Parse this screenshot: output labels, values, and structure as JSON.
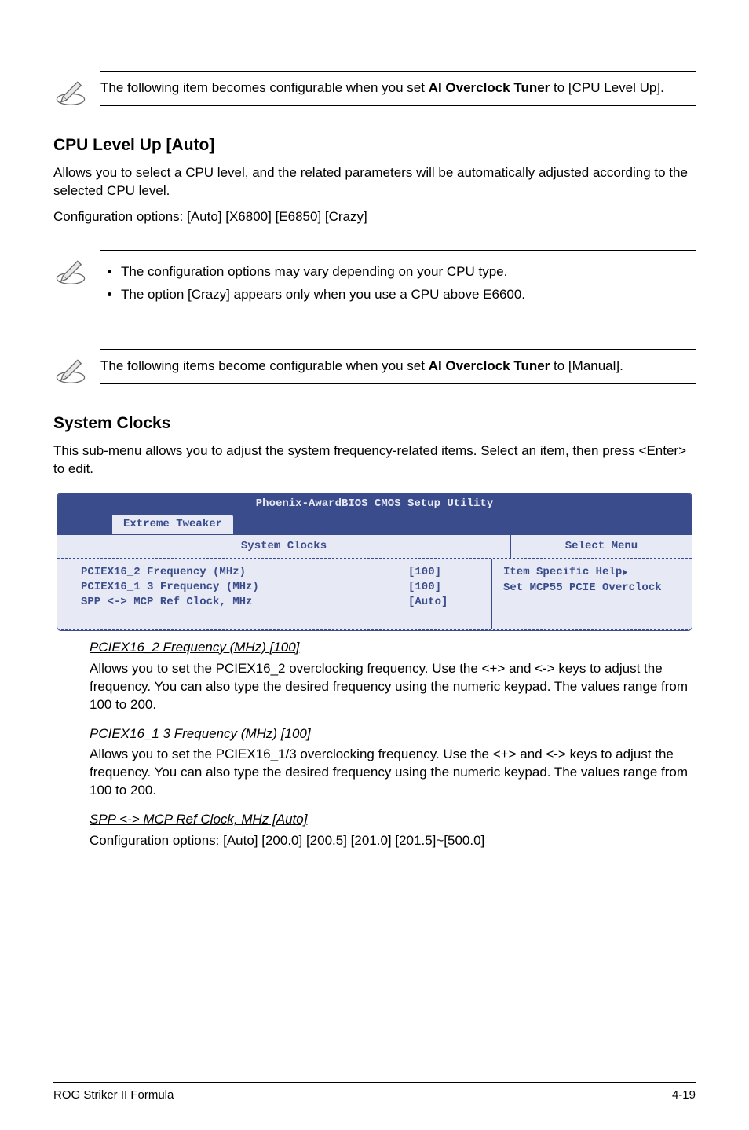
{
  "notes": {
    "note1": "The following item becomes configurable when you set <b>AI Overclock Tuner</b> to [CPU Level Up].",
    "note2_li1": "The configuration options may vary depending on your CPU type.",
    "note2_li2": "The option [Crazy] appears only when you use a CPU above E6600.",
    "note3": "The following items become configurable when you set <b>AI Overclock Tuner</b> to [Manual]."
  },
  "sections": {
    "cpu_level_up": {
      "heading": "CPU Level Up [Auto]",
      "p1": "Allows you to select a CPU level, and the related parameters will be automatically adjusted according to the selected CPU level.",
      "p2": "Configuration options: [Auto] [X6800] [E6850] [Crazy]"
    },
    "system_clocks": {
      "heading": "System Clocks",
      "p1": "This sub-menu allows you to adjust the system frequency-related items. Select an item, then press <Enter> to edit."
    }
  },
  "bios": {
    "title": "Phoenix-AwardBIOS CMOS Setup Utility",
    "tab": "Extreme Tweaker",
    "col_left": "System Clocks",
    "col_right": "Select Menu",
    "rows": [
      {
        "label": "PCIEX16_2 Frequency (MHz)",
        "value": "[100]"
      },
      {
        "label": "PCIEX16_1 3 Frequency (MHz)",
        "value": "[100]"
      },
      {
        "label": "SPP <-> MCP Ref Clock, MHz",
        "value": "[Auto]"
      }
    ],
    "help": {
      "line1": "Item Specific Help",
      "line2": "Set MCP55 PCIE Overclock"
    }
  },
  "details": {
    "d1_head": "PCIEX16_2 Frequency (MHz) [100]",
    "d1_body": "Allows you to set the PCIEX16_2 overclocking frequency. Use the <+> and <-> keys to adjust the frequency. You can also type the desired frequency using the numeric keypad. The values range from 100 to 200.",
    "d2_head": "PCIEX16_1 3 Frequency (MHz) [100]",
    "d2_body": "Allows you to set the PCIEX16_1/3 overclocking frequency. Use the <+> and <-> keys to adjust the frequency. You can also type the desired frequency using the numeric keypad. The values range from 100 to 200.",
    "d3_head": "SPP <-> MCP Ref Clock, MHz [Auto]",
    "d3_body": "Configuration options: [Auto] [200.0] [200.5] [201.0] [201.5]~[500.0]"
  },
  "footer": {
    "left": "ROG Striker II Formula",
    "right": "4-19"
  }
}
